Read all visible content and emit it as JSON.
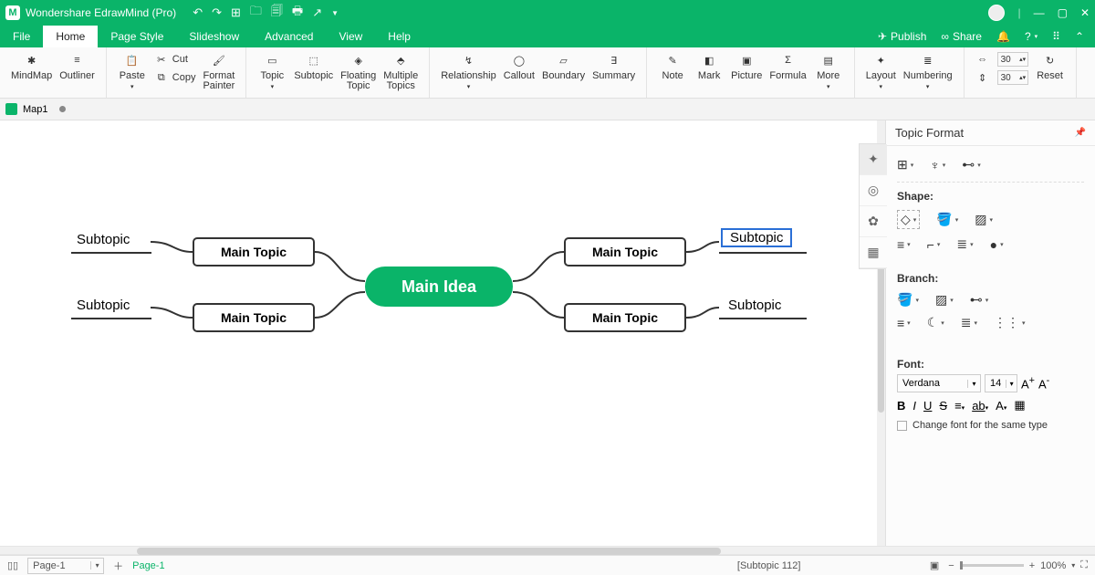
{
  "title": "Wondershare EdrawMind (Pro)",
  "qat": [
    "↶",
    "↷",
    "⊞",
    "🗀",
    "🗐",
    "🖶",
    "↗"
  ],
  "window_controls": [
    "—",
    "▢",
    "✕"
  ],
  "menubar": {
    "items": [
      "File",
      "Home",
      "Page Style",
      "Slideshow",
      "Advanced",
      "View",
      "Help"
    ],
    "active_index": 1,
    "publish": "Publish",
    "share": "Share"
  },
  "ribbon": {
    "mindmap": "MindMap",
    "outliner": "Outliner",
    "paste": "Paste",
    "cut": "Cut",
    "copy": "Copy",
    "format_painter": "Format\nPainter",
    "topic": "Topic",
    "subtopic": "Subtopic",
    "floating_topic": "Floating\nTopic",
    "multiple_topics": "Multiple\nTopics",
    "relationship": "Relationship",
    "callout": "Callout",
    "boundary": "Boundary",
    "summary": "Summary",
    "note": "Note",
    "mark": "Mark",
    "picture": "Picture",
    "formula": "Formula",
    "more": "More",
    "layout": "Layout",
    "numbering": "Numbering",
    "width_val": "30",
    "height_val": "30",
    "reset": "Reset"
  },
  "doctab": {
    "name": "Map1"
  },
  "mindmap": {
    "central": "Main Idea",
    "main_topics": [
      "Main Topic",
      "Main Topic",
      "Main Topic",
      "Main Topic"
    ],
    "subtopics": [
      "Subtopic",
      "Subtopic",
      "Subtopic",
      "Subtopic"
    ],
    "selected_subtopic_index": 2
  },
  "format_panel": {
    "title": "Topic Format",
    "shape_label": "Shape:",
    "branch_label": "Branch:",
    "font_label": "Font:",
    "font_name": "Verdana",
    "font_size": "14",
    "change_font": "Change font for the same type"
  },
  "status": {
    "page_combo": "Page-1",
    "page_link": "Page-1",
    "selection": "[Subtopic 112]",
    "zoom": "100%"
  }
}
